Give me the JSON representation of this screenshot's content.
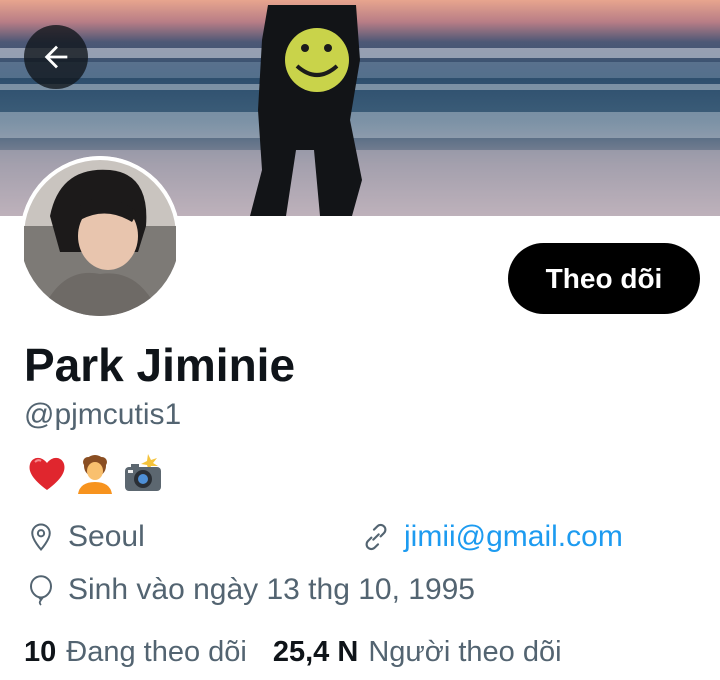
{
  "profile": {
    "name": "Park Jiminie",
    "handle": "@pjmcutis1",
    "bio_emojis": [
      "heart-emoji",
      "person-curly-hair-emoji",
      "camera-flash-emoji"
    ],
    "location": "Seoul",
    "website": "jimii@gmail.com",
    "birthday": "Sinh vào ngày 13 thg 10, 1995"
  },
  "actions": {
    "follow_label": "Theo dõi"
  },
  "stats": {
    "following_count": "10",
    "following_label": "Đang theo dõi",
    "followers_count": "25,4 N",
    "followers_label": "Người theo dõi"
  },
  "colors": {
    "accent": "#1d9bf0",
    "text_primary": "#0f1419",
    "text_secondary": "#536471",
    "button_bg": "#000000"
  }
}
